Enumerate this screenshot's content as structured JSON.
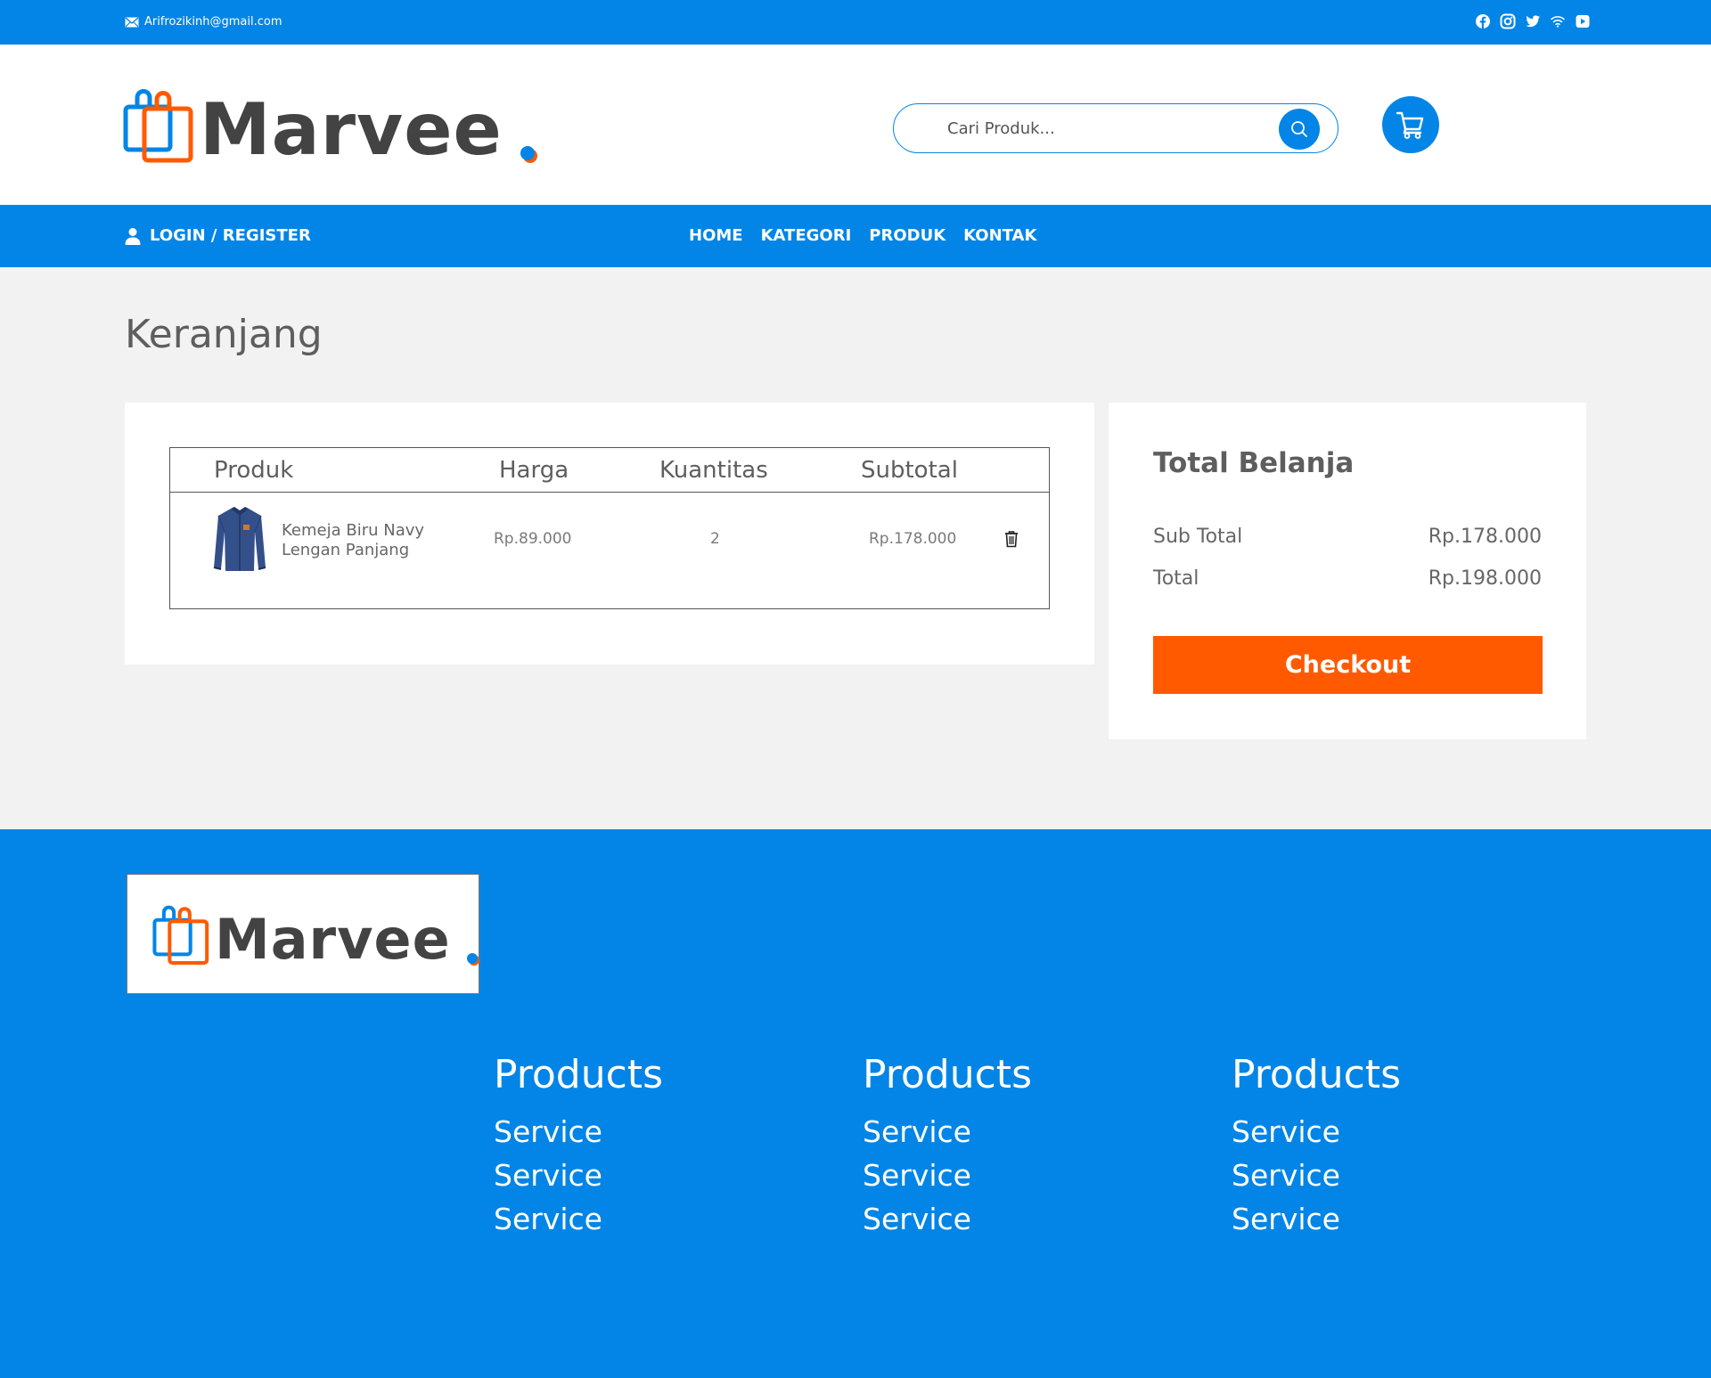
{
  "topbar": {
    "email": "Arifrozikinh@gmail.com",
    "socials": [
      "facebook-icon",
      "instagram-icon",
      "twitter-icon",
      "wifi-icon",
      "youtube-icon"
    ]
  },
  "brand": {
    "name": "Marvee"
  },
  "search": {
    "placeholder": "Cari Produk..."
  },
  "nav": {
    "login": "LOGIN / REGISTER",
    "items": [
      "HOME",
      "KATEGORI",
      "PRODUK",
      "KONTAK"
    ]
  },
  "page": {
    "title": "Keranjang"
  },
  "cart": {
    "headers": [
      "Produk",
      "Harga",
      "Kuantitas",
      "Subtotal"
    ],
    "items": [
      {
        "name_line1": "Kemeja Biru Navy",
        "name_line2": "Lengan Panjang",
        "price": "Rp.89.000",
        "qty": "2",
        "subtotal": "Rp.178.000"
      }
    ]
  },
  "summary": {
    "title": "Total Belanja",
    "subtotal_label": "Sub Total",
    "subtotal_value": "Rp.178.000",
    "total_label": "Total",
    "total_value": "Rp.198.000",
    "checkout": "Checkout"
  },
  "footer": {
    "columns": [
      {
        "heading": "Products",
        "links": [
          "Service",
          "Service",
          "Service"
        ]
      },
      {
        "heading": "Products",
        "links": [
          "Service",
          "Service",
          "Service"
        ]
      },
      {
        "heading": "Products",
        "links": [
          "Service",
          "Service",
          "Service"
        ]
      }
    ]
  },
  "colors": {
    "primary": "#0285e6",
    "accent": "#ff5a00",
    "text": "#434343",
    "background": "#f2f2f2"
  }
}
